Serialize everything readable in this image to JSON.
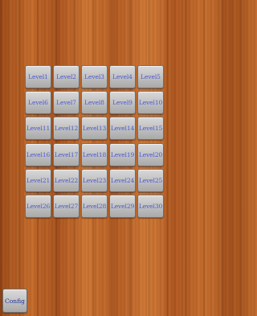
{
  "levels": [
    {
      "label": "Level1"
    },
    {
      "label": "Level2"
    },
    {
      "label": "Level3"
    },
    {
      "label": "Level4"
    },
    {
      "label": "Level5"
    },
    {
      "label": "Level6"
    },
    {
      "label": "Level7"
    },
    {
      "label": "Level8"
    },
    {
      "label": "Level9"
    },
    {
      "label": "Level10"
    },
    {
      "label": "Level11"
    },
    {
      "label": "Level12"
    },
    {
      "label": "Level13"
    },
    {
      "label": "Level14"
    },
    {
      "label": "Level15"
    },
    {
      "label": "Level16"
    },
    {
      "label": "Level17"
    },
    {
      "label": "Level18"
    },
    {
      "label": "Level19"
    },
    {
      "label": "Level20"
    },
    {
      "label": "Level21"
    },
    {
      "label": "Level22"
    },
    {
      "label": "Level23"
    },
    {
      "label": "Level24"
    },
    {
      "label": "Level25"
    },
    {
      "label": "Level26"
    },
    {
      "label": "Level27"
    },
    {
      "label": "Level28"
    },
    {
      "label": "Level29"
    },
    {
      "label": "Level30"
    }
  ],
  "config": {
    "label": "Config"
  },
  "colors": {
    "button_text": "#4a5ad0",
    "config_text": "#1f2f9a",
    "background_wood": "#b55e24"
  }
}
